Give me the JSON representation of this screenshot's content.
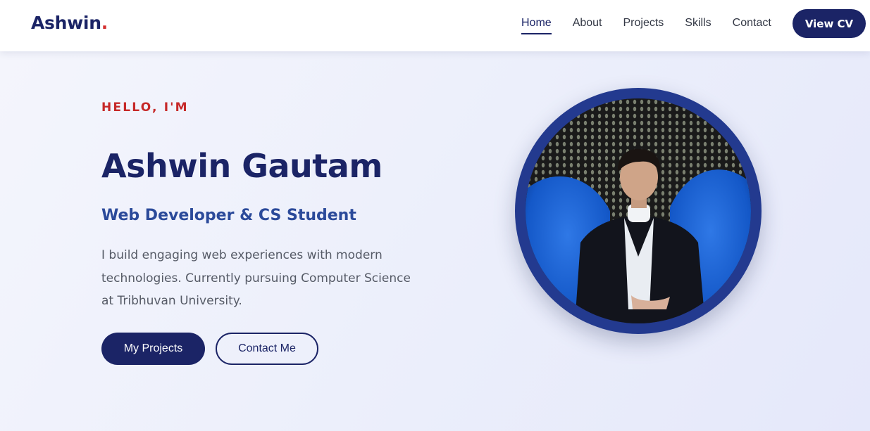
{
  "nav": {
    "logo_text": "Ashwin",
    "logo_dot": ".",
    "links": [
      {
        "label": "Home",
        "active": true
      },
      {
        "label": "About"
      },
      {
        "label": "Projects"
      },
      {
        "label": "Skills"
      },
      {
        "label": "Contact"
      }
    ],
    "cv_label": "View CV"
  },
  "hero": {
    "greeting": "HELLO, I'M",
    "name": "Ashwin Gautam",
    "role": "Web Developer & CS Student",
    "bio": "I build engaging web experiences with modern technologies. Currently pursuing Computer Science at Tribhuvan University.",
    "primary_button": "My Projects",
    "secondary_button": "Contact Me"
  },
  "colors": {
    "brand_navy": "#1b2466",
    "accent_red": "#c62828",
    "role_blue": "#2b4a9a",
    "body_text": "#555a66"
  }
}
